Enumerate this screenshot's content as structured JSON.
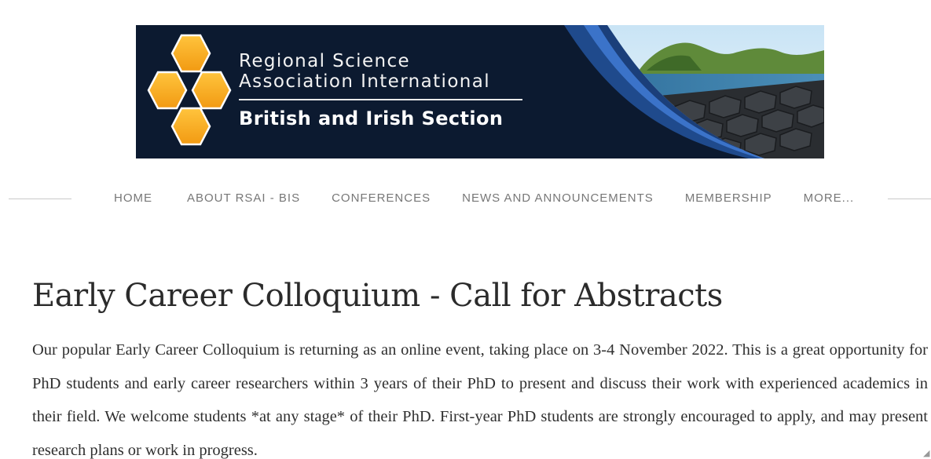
{
  "banner": {
    "line1": "Regional Science",
    "line2": "Association International",
    "section": "British and Irish Section",
    "colors": {
      "background": "#0c1a30",
      "hexagon": "#f5a623",
      "wave": "#2a5db0"
    }
  },
  "nav": {
    "items": [
      {
        "label": "HOME"
      },
      {
        "label": "ABOUT RSAI - BIS"
      },
      {
        "label": "CONFERENCES"
      },
      {
        "label": "NEWS AND ANNOUNCEMENTS"
      },
      {
        "label": "MEMBERSHIP"
      },
      {
        "label": "MORE..."
      }
    ]
  },
  "main": {
    "title": "Early Career Colloquium - Call for Abstracts",
    "body": "Our popular Early Career Colloquium is returning as an online event, taking place on 3-4 November 2022. This is a great opportunity for PhD students and early career researchers within 3 years of their PhD to present and discuss their work with experienced academics in their field. We welcome students *at any stage* of their PhD. First-year PhD students are strongly encouraged to apply, and may present research plans or work in progress."
  }
}
